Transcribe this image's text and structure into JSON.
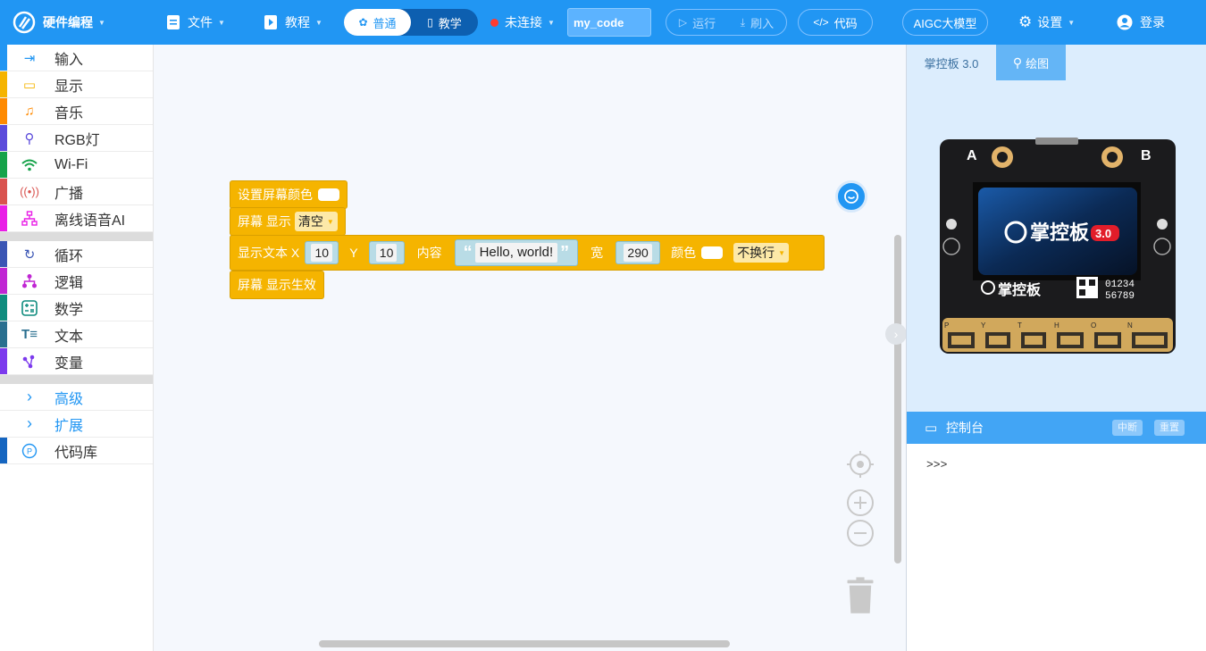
{
  "topbar": {
    "app_name": "硬件编程",
    "file_label": "文件",
    "tutorial_label": "教程",
    "mode_normal": "普通",
    "mode_teach": "教学",
    "connection_status": "未连接",
    "code_name": "my_code",
    "run_label": "运行",
    "flash_label": "刷入",
    "code_label": "代码",
    "aigc_label": "AIGC大模型",
    "settings_label": "设置",
    "login_label": "登录",
    "status_color": "#ff3b30"
  },
  "sidebar": {
    "categories": [
      {
        "label": "输入",
        "icon": "input-icon",
        "color": "#2196f3"
      },
      {
        "label": "显示",
        "icon": "display-icon",
        "color": "#f5b400"
      },
      {
        "label": "音乐",
        "icon": "music-icon",
        "color": "#ff8a00"
      },
      {
        "label": "RGB灯",
        "icon": "bulb-icon",
        "color": "#5b4bdb"
      },
      {
        "label": "Wi-Fi",
        "icon": "wifi-icon",
        "color": "#16a34a"
      },
      {
        "label": "广播",
        "icon": "broadcast-icon",
        "color": "#d9534f"
      },
      {
        "label": "离线语音AI",
        "icon": "network-icon",
        "color": "#e91ee6"
      }
    ],
    "categories2": [
      {
        "label": "循环",
        "icon": "loop-icon",
        "color": "#3a55b4"
      },
      {
        "label": "逻辑",
        "icon": "logic-icon",
        "color": "#c026d3"
      },
      {
        "label": "数学",
        "icon": "math-icon",
        "color": "#0f8c7e"
      },
      {
        "label": "文本",
        "icon": "text-icon",
        "color": "#2a6f8f"
      },
      {
        "label": "变量",
        "icon": "variable-icon",
        "color": "#7c3aed"
      }
    ],
    "advanced_label": "高级",
    "extension_label": "扩展",
    "codelib_label": "代码库"
  },
  "blocks": {
    "set_screen_color": "设置屏幕颜色",
    "screen_show": "屏幕 显示",
    "clear_option": "清空",
    "show_text": "显示文本 X",
    "x_value": "10",
    "y_label": "Y",
    "y_value": "10",
    "content_label": "内容",
    "text_value": "Hello, world!",
    "width_label": "宽",
    "width_value": "290",
    "color_label": "颜色",
    "wrap_option": "不换行",
    "screen_refresh": "屏幕 显示生效"
  },
  "right_panel": {
    "board_tab": "掌控板 3.0",
    "draw_tab": "绘图",
    "console_title": "控制台",
    "interrupt_label": "中断",
    "reset_label": "重置",
    "prompt": ">>>",
    "board": {
      "brand": "掌控板",
      "version": "3.0",
      "serial_1": "01234",
      "serial_2": "56789",
      "button_a": "A",
      "button_b": "B",
      "pins": [
        "P",
        "Y",
        "T",
        "H",
        "O",
        "N"
      ]
    }
  }
}
